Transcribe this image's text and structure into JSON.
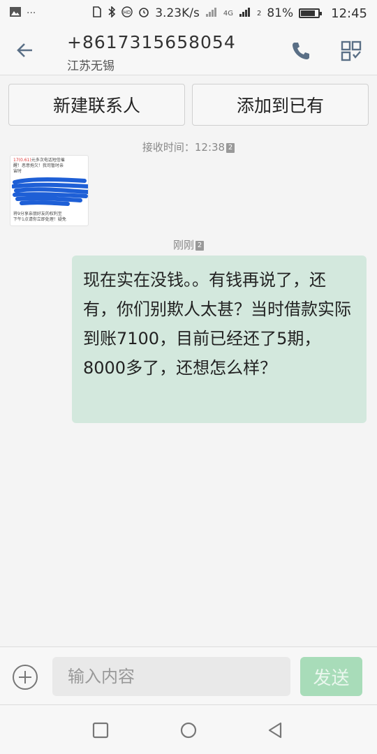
{
  "status_bar": {
    "left_icons": [
      "image-icon",
      "more-icon"
    ],
    "network_speed": "3.23K/s",
    "network_type": "4G",
    "sim_label": "2",
    "battery": "81%",
    "battery_level": 0.81,
    "time": "12:45"
  },
  "header": {
    "phone_number": "+8617315658054",
    "location": "江苏无锡"
  },
  "actions": {
    "new_contact": "新建联系人",
    "add_existing": "添加到已有"
  },
  "messages": {
    "received_time": "接收时间：12:38",
    "received_sim": "2",
    "image_text_top_red": "17(0.61)",
    "image_text_top": "元多次电话短信催",
    "image_text_line2": "醒！恶意拖欠！我司暂时亲",
    "image_text_line3": "宙时",
    "image_text_bottom1": "将9分享亲朋好友的权利至",
    "image_text_bottom2": "下午1点请你立即处理！疑免",
    "sent_time": "刚刚",
    "sent_sim": "2",
    "sent_text": "现在实在没钱。。有钱再说了，还有，你们别欺人太甚？当时借款实际到账7100，目前已经还了5期，8000多了，还想怎么样？"
  },
  "composer": {
    "placeholder": "输入内容",
    "send_label": "发送"
  },
  "colors": {
    "bubble": "#d3e8dd",
    "send_button": "#a8dcb9",
    "header_icon": "#5a6f86"
  }
}
